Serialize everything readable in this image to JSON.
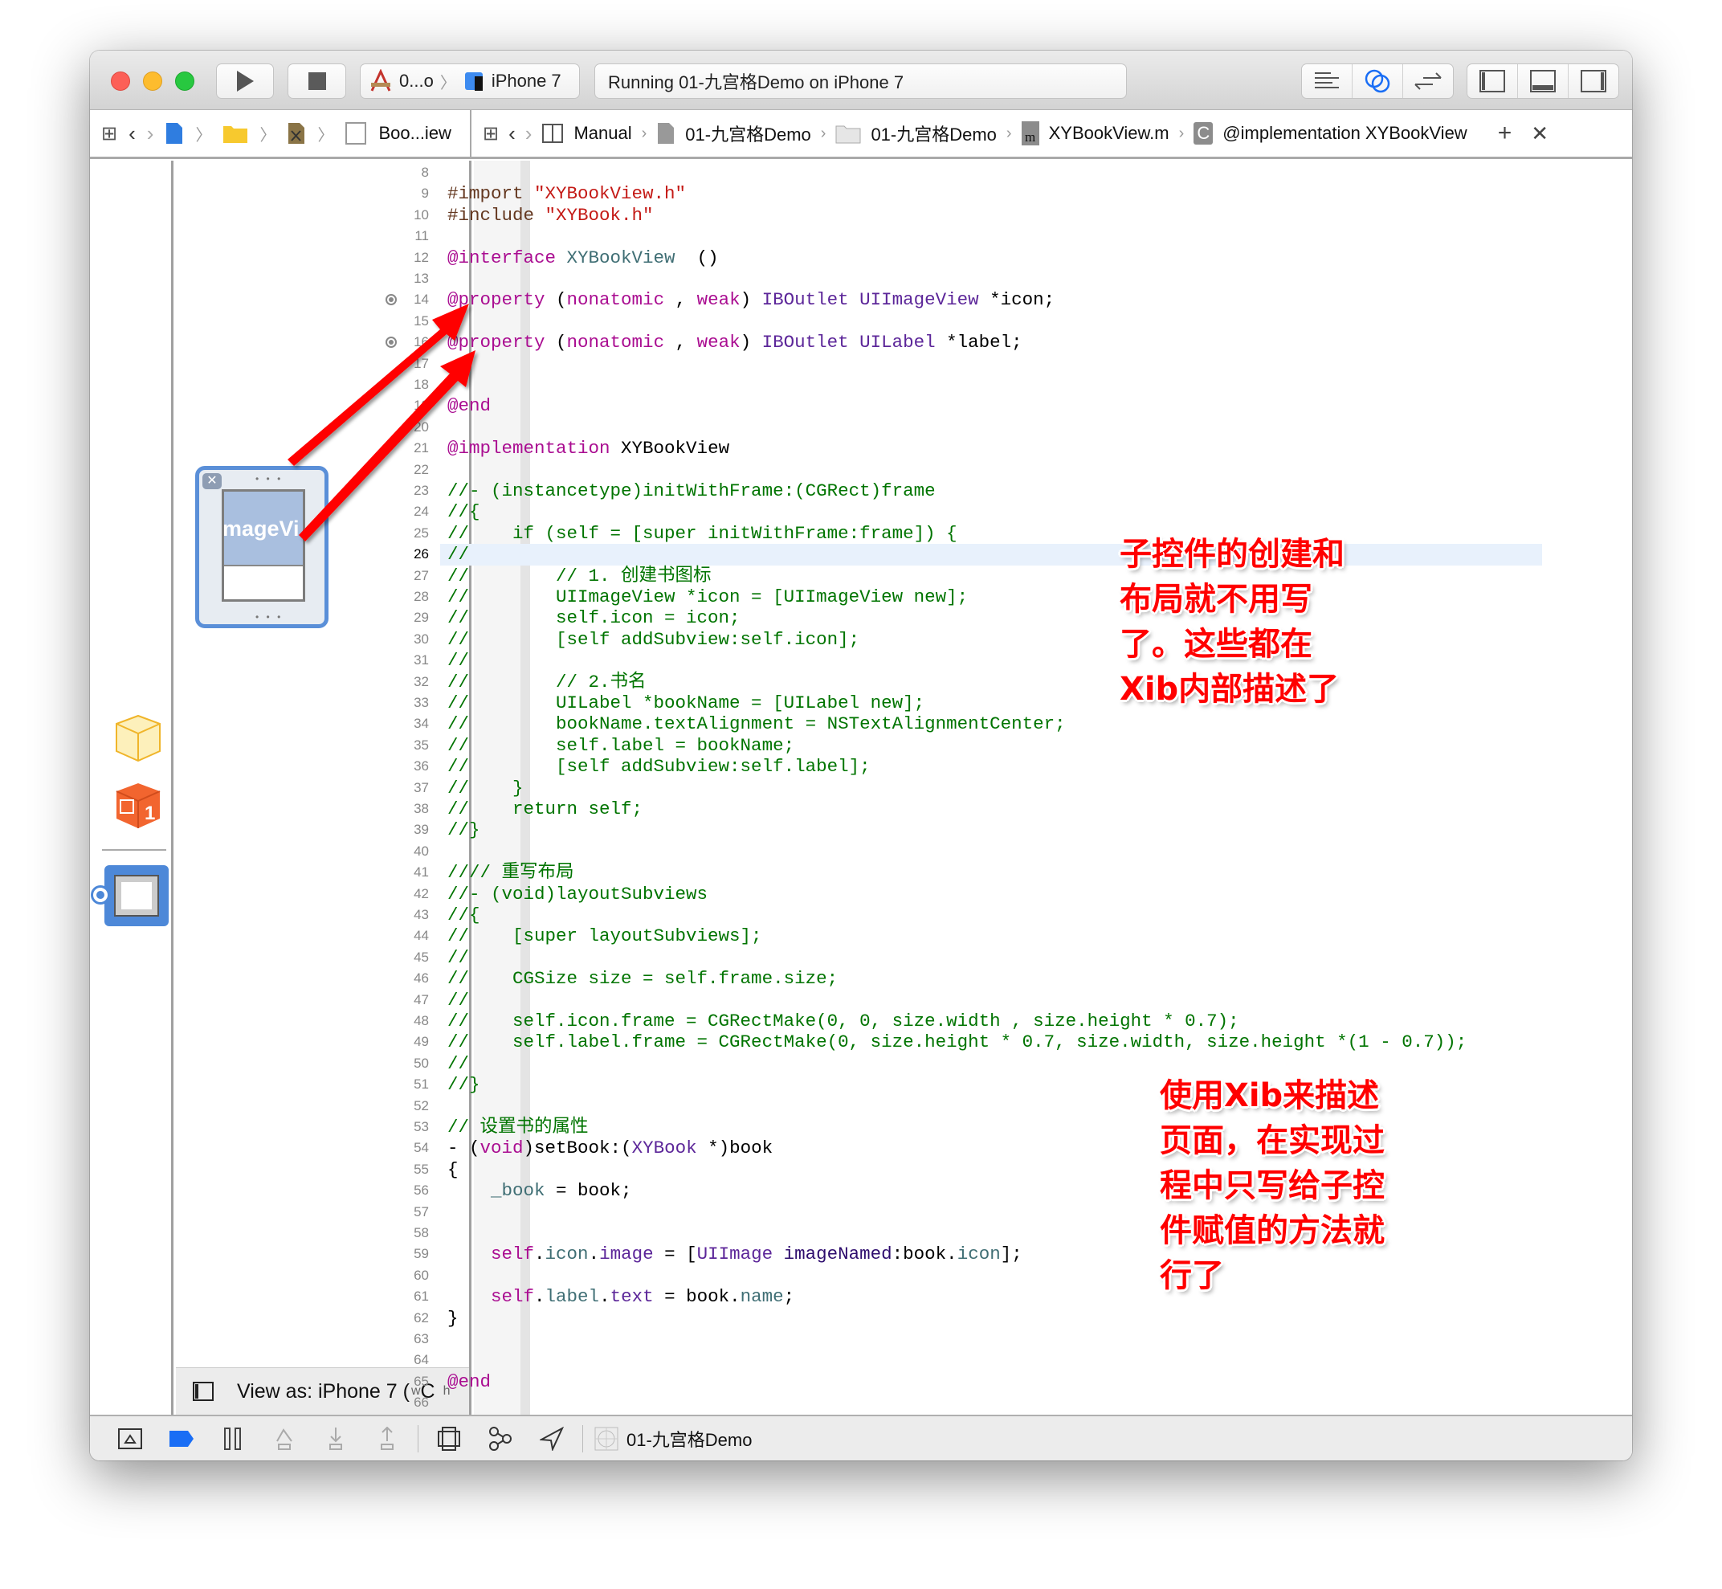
{
  "toolbar": {
    "scheme_target": "0...o",
    "device": "iPhone 7",
    "activity": "Running 01-九宫格Demo on iPhone 7"
  },
  "jumpbar_left": {
    "file": "Boo...iew"
  },
  "jumpbar_right": {
    "mode": "Manual",
    "items": [
      "01-九宫格Demo",
      "01-九宫格Demo",
      "XYBookView.m",
      "@implementation XYBookView"
    ],
    "file_icon_letter": "m",
    "class_icon_letter": "C"
  },
  "canvas": {
    "imageview_label": "mageVi",
    "view_as": "View as: iPhone 7 (",
    "size_class_w": "w",
    "size_class_w_val": "C",
    "size_class_h": "h",
    "scene_badge": "1"
  },
  "editor": {
    "first_line": 8,
    "current_line": 26,
    "outlet_lines": [
      14,
      16
    ],
    "lines": [
      [],
      [
        [
          "pre",
          "#import "
        ],
        [
          "str",
          "\"XYBookView.h\""
        ]
      ],
      [
        [
          "pre",
          "#include "
        ],
        [
          "str",
          "\"XYBook.h\""
        ]
      ],
      [],
      [
        [
          "kw",
          "@interface "
        ],
        [
          "typ",
          "XYBookView"
        ],
        [
          "",
          "  ()"
        ]
      ],
      [],
      [
        [
          "kw",
          "@property "
        ],
        [
          "",
          "("
        ],
        [
          "kw",
          "nonatomic"
        ],
        [
          "",
          " ,"
        ],
        [
          "kw",
          " weak"
        ],
        [
          "",
          ") "
        ],
        [
          "cls",
          "IBOutlet UIImageView "
        ],
        [
          "",
          "*icon;"
        ]
      ],
      [],
      [
        [
          "kw",
          "@property "
        ],
        [
          "",
          "("
        ],
        [
          "kw",
          "nonatomic"
        ],
        [
          "",
          " ,"
        ],
        [
          "kw",
          " weak"
        ],
        [
          "",
          ") "
        ],
        [
          "cls",
          "IBOutlet UILabel "
        ],
        [
          "",
          "*label;"
        ]
      ],
      [],
      [],
      [
        [
          "kw",
          "@end"
        ]
      ],
      [],
      [
        [
          "kw",
          "@implementation "
        ],
        [
          "",
          "XYBookView"
        ]
      ],
      [],
      [
        [
          "com",
          "//- (instancetype)initWithFrame:(CGRect)frame"
        ]
      ],
      [
        [
          "com",
          "//{"
        ]
      ],
      [
        [
          "com",
          "//    if (self = [super initWithFrame:frame]) {"
        ]
      ],
      [
        [
          "com",
          "//"
        ]
      ],
      [
        [
          "com",
          "//        // 1. 创建书图标"
        ]
      ],
      [
        [
          "com",
          "//        UIImageView *icon = [UIImageView new];"
        ]
      ],
      [
        [
          "com",
          "//        self.icon = icon;"
        ]
      ],
      [
        [
          "com",
          "//        [self addSubview:self.icon];"
        ]
      ],
      [
        [
          "com",
          "//"
        ]
      ],
      [
        [
          "com",
          "//        // 2.书名"
        ]
      ],
      [
        [
          "com",
          "//        UILabel *bookName = [UILabel new];"
        ]
      ],
      [
        [
          "com",
          "//        bookName.textAlignment = NSTextAlignmentCenter;"
        ]
      ],
      [
        [
          "com",
          "//        self.label = bookName;"
        ]
      ],
      [
        [
          "com",
          "//        [self addSubview:self.label];"
        ]
      ],
      [
        [
          "com",
          "//    }"
        ]
      ],
      [
        [
          "com",
          "//    return self;"
        ]
      ],
      [
        [
          "com",
          "//}"
        ]
      ],
      [],
      [
        [
          "com",
          "//// 重写布局"
        ]
      ],
      [
        [
          "com",
          "//- (void)layoutSubviews"
        ]
      ],
      [
        [
          "com",
          "//{"
        ]
      ],
      [
        [
          "com",
          "//    [super layoutSubviews];"
        ]
      ],
      [
        [
          "com",
          "//"
        ]
      ],
      [
        [
          "com",
          "//    CGSize size = self.frame.size;"
        ]
      ],
      [
        [
          "com",
          "//"
        ]
      ],
      [
        [
          "com",
          "//    self.icon.frame = CGRectMake(0, 0, size.width , size.height * 0.7);"
        ]
      ],
      [
        [
          "com",
          "//    self.label.frame = CGRectMake(0, size.height * 0.7, size.width, size.height *(1 - 0.7));"
        ]
      ],
      [
        [
          "com",
          "//"
        ]
      ],
      [
        [
          "com",
          "//}"
        ]
      ],
      [],
      [
        [
          "com",
          "// 设置书的属性"
        ]
      ],
      [
        [
          "",
          "- ("
        ],
        [
          "kw",
          "void"
        ],
        [
          "",
          ")setBook:("
        ],
        [
          "cls",
          "XYBook"
        ],
        [
          "",
          " *)book"
        ]
      ],
      [
        [
          "",
          "{"
        ]
      ],
      [
        [
          "",
          "    "
        ],
        [
          "typ",
          "_book"
        ],
        [
          "",
          " = book;"
        ]
      ],
      [],
      [],
      [
        [
          "",
          "    "
        ],
        [
          "kw",
          "self"
        ],
        [
          "",
          "."
        ],
        [
          "prop",
          "icon"
        ],
        [
          "",
          "."
        ],
        [
          "cls",
          "image"
        ],
        [
          "",
          " = ["
        ],
        [
          "cls",
          "UIImage"
        ],
        [
          "",
          " "
        ],
        [
          "meth",
          "imageNamed"
        ],
        [
          "",
          ":book."
        ],
        [
          "prop",
          "icon"
        ],
        [
          "",
          "];"
        ]
      ],
      [],
      [
        [
          "",
          "    "
        ],
        [
          "kw",
          "self"
        ],
        [
          "",
          "."
        ],
        [
          "prop",
          "label"
        ],
        [
          "",
          "."
        ],
        [
          "cls",
          "text"
        ],
        [
          "",
          " = book."
        ],
        [
          "prop",
          "name"
        ],
        [
          "",
          ";"
        ]
      ],
      [
        [
          "",
          "}"
        ]
      ],
      [],
      [],
      [
        [
          "kw",
          "@end"
        ]
      ],
      []
    ]
  },
  "annotations": [
    [
      "子控件的创建和",
      "布局就不用写",
      "了。这些都在",
      "Xib内部描述了"
    ],
    [
      "使用Xib来描述",
      "页面，在实现过",
      "程中只写给子控",
      "件赋值的方法就",
      "行了"
    ]
  ],
  "debug_bar": {
    "target": "01-九宫格Demo"
  },
  "colors": {
    "annotation": "#ff0000",
    "arrow": "#ff0000",
    "keyword": "#aa0d91",
    "string": "#c41a16",
    "comment": "#007400",
    "class": "#5c2699",
    "accent": "#1a6ef5"
  }
}
